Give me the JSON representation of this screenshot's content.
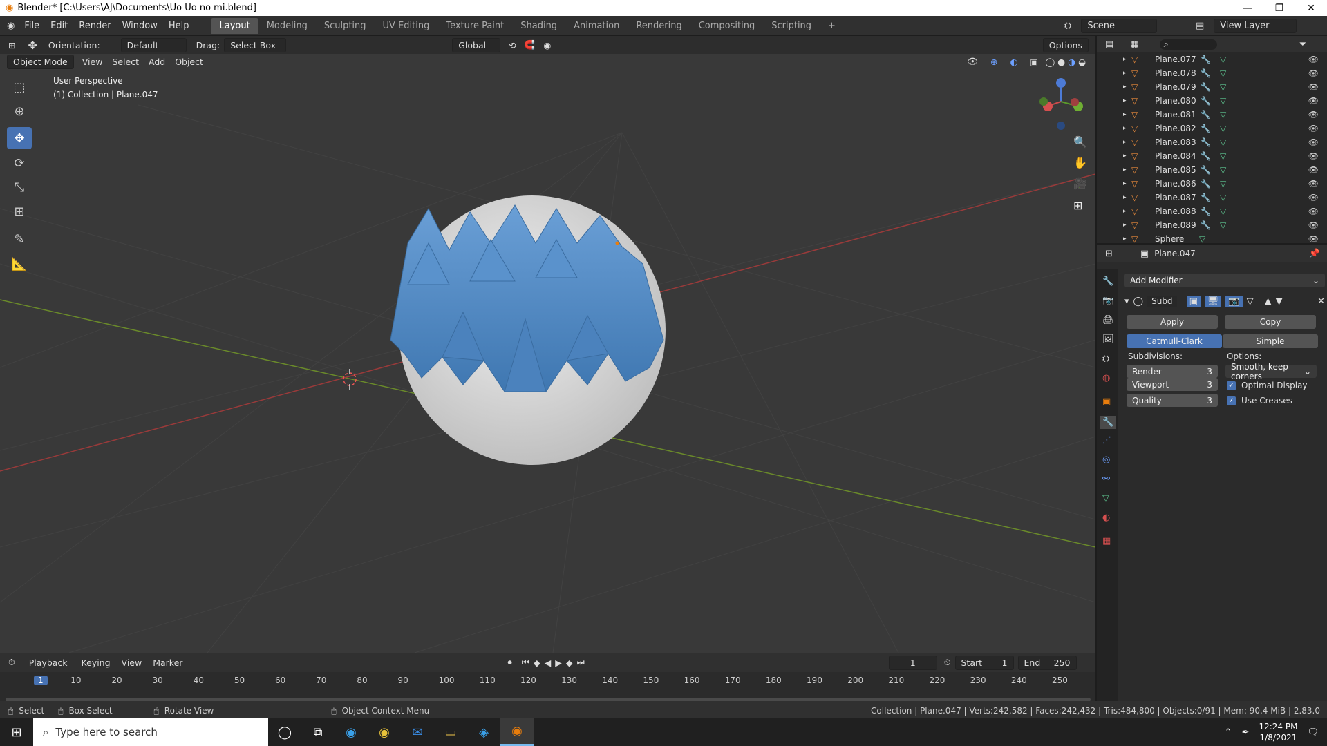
{
  "window": {
    "title": "Blender* [C:\\Users\\AJ\\Documents\\Uo Uo no mi.blend]",
    "min": "—",
    "max": "❐",
    "close": "✕"
  },
  "topmenu": [
    "File",
    "Edit",
    "Render",
    "Window",
    "Help"
  ],
  "workspaces": [
    "Layout",
    "Modeling",
    "Sculpting",
    "UV Editing",
    "Texture Paint",
    "Shading",
    "Animation",
    "Rendering",
    "Compositing",
    "Scripting"
  ],
  "scene": "Scene",
  "viewlayer": "View Layer",
  "toolsettings": {
    "orientation_label": "Orientation:",
    "orientation": "Default",
    "drag_label": "Drag:",
    "drag": "Select Box",
    "transform": "Global",
    "options": "Options"
  },
  "viewport_header": {
    "mode": "Object Mode",
    "menus": [
      "View",
      "Select",
      "Add",
      "Object"
    ]
  },
  "viewport_overlay": {
    "perspective": "User Perspective",
    "collection": "(1) Collection | Plane.047"
  },
  "outliner": {
    "items": [
      "Plane.077",
      "Plane.078",
      "Plane.079",
      "Plane.080",
      "Plane.081",
      "Plane.082",
      "Plane.083",
      "Plane.084",
      "Plane.085",
      "Plane.086",
      "Plane.087",
      "Plane.088",
      "Plane.089",
      "Sphere"
    ]
  },
  "properties": {
    "object": "Plane.047",
    "add_modifier": "Add Modifier",
    "modifier_name": "Subd",
    "apply": "Apply",
    "copy": "Copy",
    "catmull": "Catmull-Clark",
    "simple": "Simple",
    "subdivisions_label": "Subdivisions:",
    "options_label": "Options:",
    "render_label": "Render",
    "render_val": "3",
    "viewport_label": "Viewport",
    "viewport_val": "3",
    "quality_label": "Quality",
    "quality_val": "3",
    "uv_smooth": "Smooth, keep corners",
    "optimal": "Optimal Display",
    "creases": "Use Creases"
  },
  "timeline": {
    "menus": [
      "Playback",
      "Keying",
      "View",
      "Marker"
    ],
    "current": "1",
    "start_label": "Start",
    "start": "1",
    "end_label": "End",
    "end": "250",
    "ticks": [
      "1",
      "10",
      "20",
      "30",
      "40",
      "50",
      "60",
      "70",
      "80",
      "90",
      "100",
      "110",
      "120",
      "130",
      "140",
      "150",
      "160",
      "170",
      "180",
      "190",
      "200",
      "210",
      "220",
      "230",
      "240",
      "250"
    ]
  },
  "status": {
    "select": "Select",
    "box_select": "Box Select",
    "rotate": "Rotate View",
    "context": "Object Context Menu",
    "stats": "Collection | Plane.047 | Verts:242,582 | Faces:242,432 | Tris:484,800 | Objects:0/91 | Mem: 90.4 MiB | 2.83.0"
  },
  "taskbar": {
    "search_placeholder": "Type here to search",
    "time": "12:24 PM",
    "date": "1/8/2021"
  },
  "colors": {
    "accent": "#4772b3",
    "scales": "#4e87c0",
    "sphere": "#d8d8d8"
  }
}
